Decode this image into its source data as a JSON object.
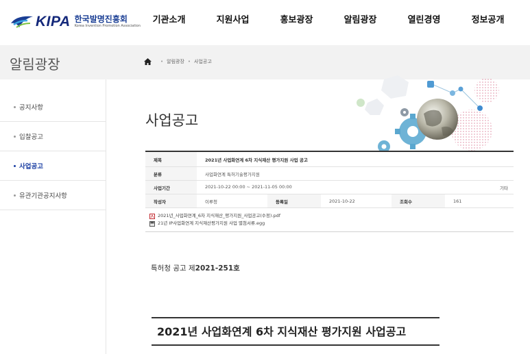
{
  "header": {
    "logo_text": "KIPA",
    "logo_kr": "한국발명진흥회",
    "logo_en": "Korea Invention Promotion Association",
    "nav": [
      "기관소개",
      "지원사업",
      "홍보광장",
      "알림광장",
      "열린경영",
      "정보공개"
    ]
  },
  "subbar": {
    "title": "알림광장",
    "breadcrumb": [
      "알림광장",
      "사업공고"
    ]
  },
  "sidebar": {
    "items": [
      {
        "label": "공지사항",
        "active": false
      },
      {
        "label": "입찰공고",
        "active": false
      },
      {
        "label": "사업공고",
        "active": true
      },
      {
        "label": "유관기관공지사항",
        "active": false
      }
    ]
  },
  "main": {
    "page_title": "사업공고",
    "board": {
      "title_label": "제목",
      "title_value": "2021년 사업화연계 6차 지식재산 평가지원 사업 공고",
      "category_label": "분류",
      "category_value": "사업화연계 특허기술평가지원",
      "period_label": "사업기간",
      "period_value": "2021-10-22 00:00 ~ 2021-11-05 00:00",
      "period_extra": "기타",
      "author_label": "작성자",
      "author_value": "이루청",
      "date_label": "등록일",
      "date_value": "2021-10-22",
      "views_label": "조회수",
      "views_value": "161",
      "files": [
        {
          "name": "2021년_사업화연계_6차 지식재산_평가지원_사업공고(수정).pdf",
          "icon": "pdf-icon"
        },
        {
          "name": "21년 IP사업화연계 지식재산평가지원 사업 별첨서류.egg",
          "icon": "archive-icon"
        }
      ]
    },
    "notice_number_prefix": "특허청 공고 제",
    "notice_number_value": "2021-251호",
    "body_title": "2021년 사업화연계 6차 지식재산 평가지원 사업공고"
  },
  "colors": {
    "brand": "#14287a",
    "active": "#1a3ea3",
    "subbar_bg": "#f2f2f2"
  }
}
